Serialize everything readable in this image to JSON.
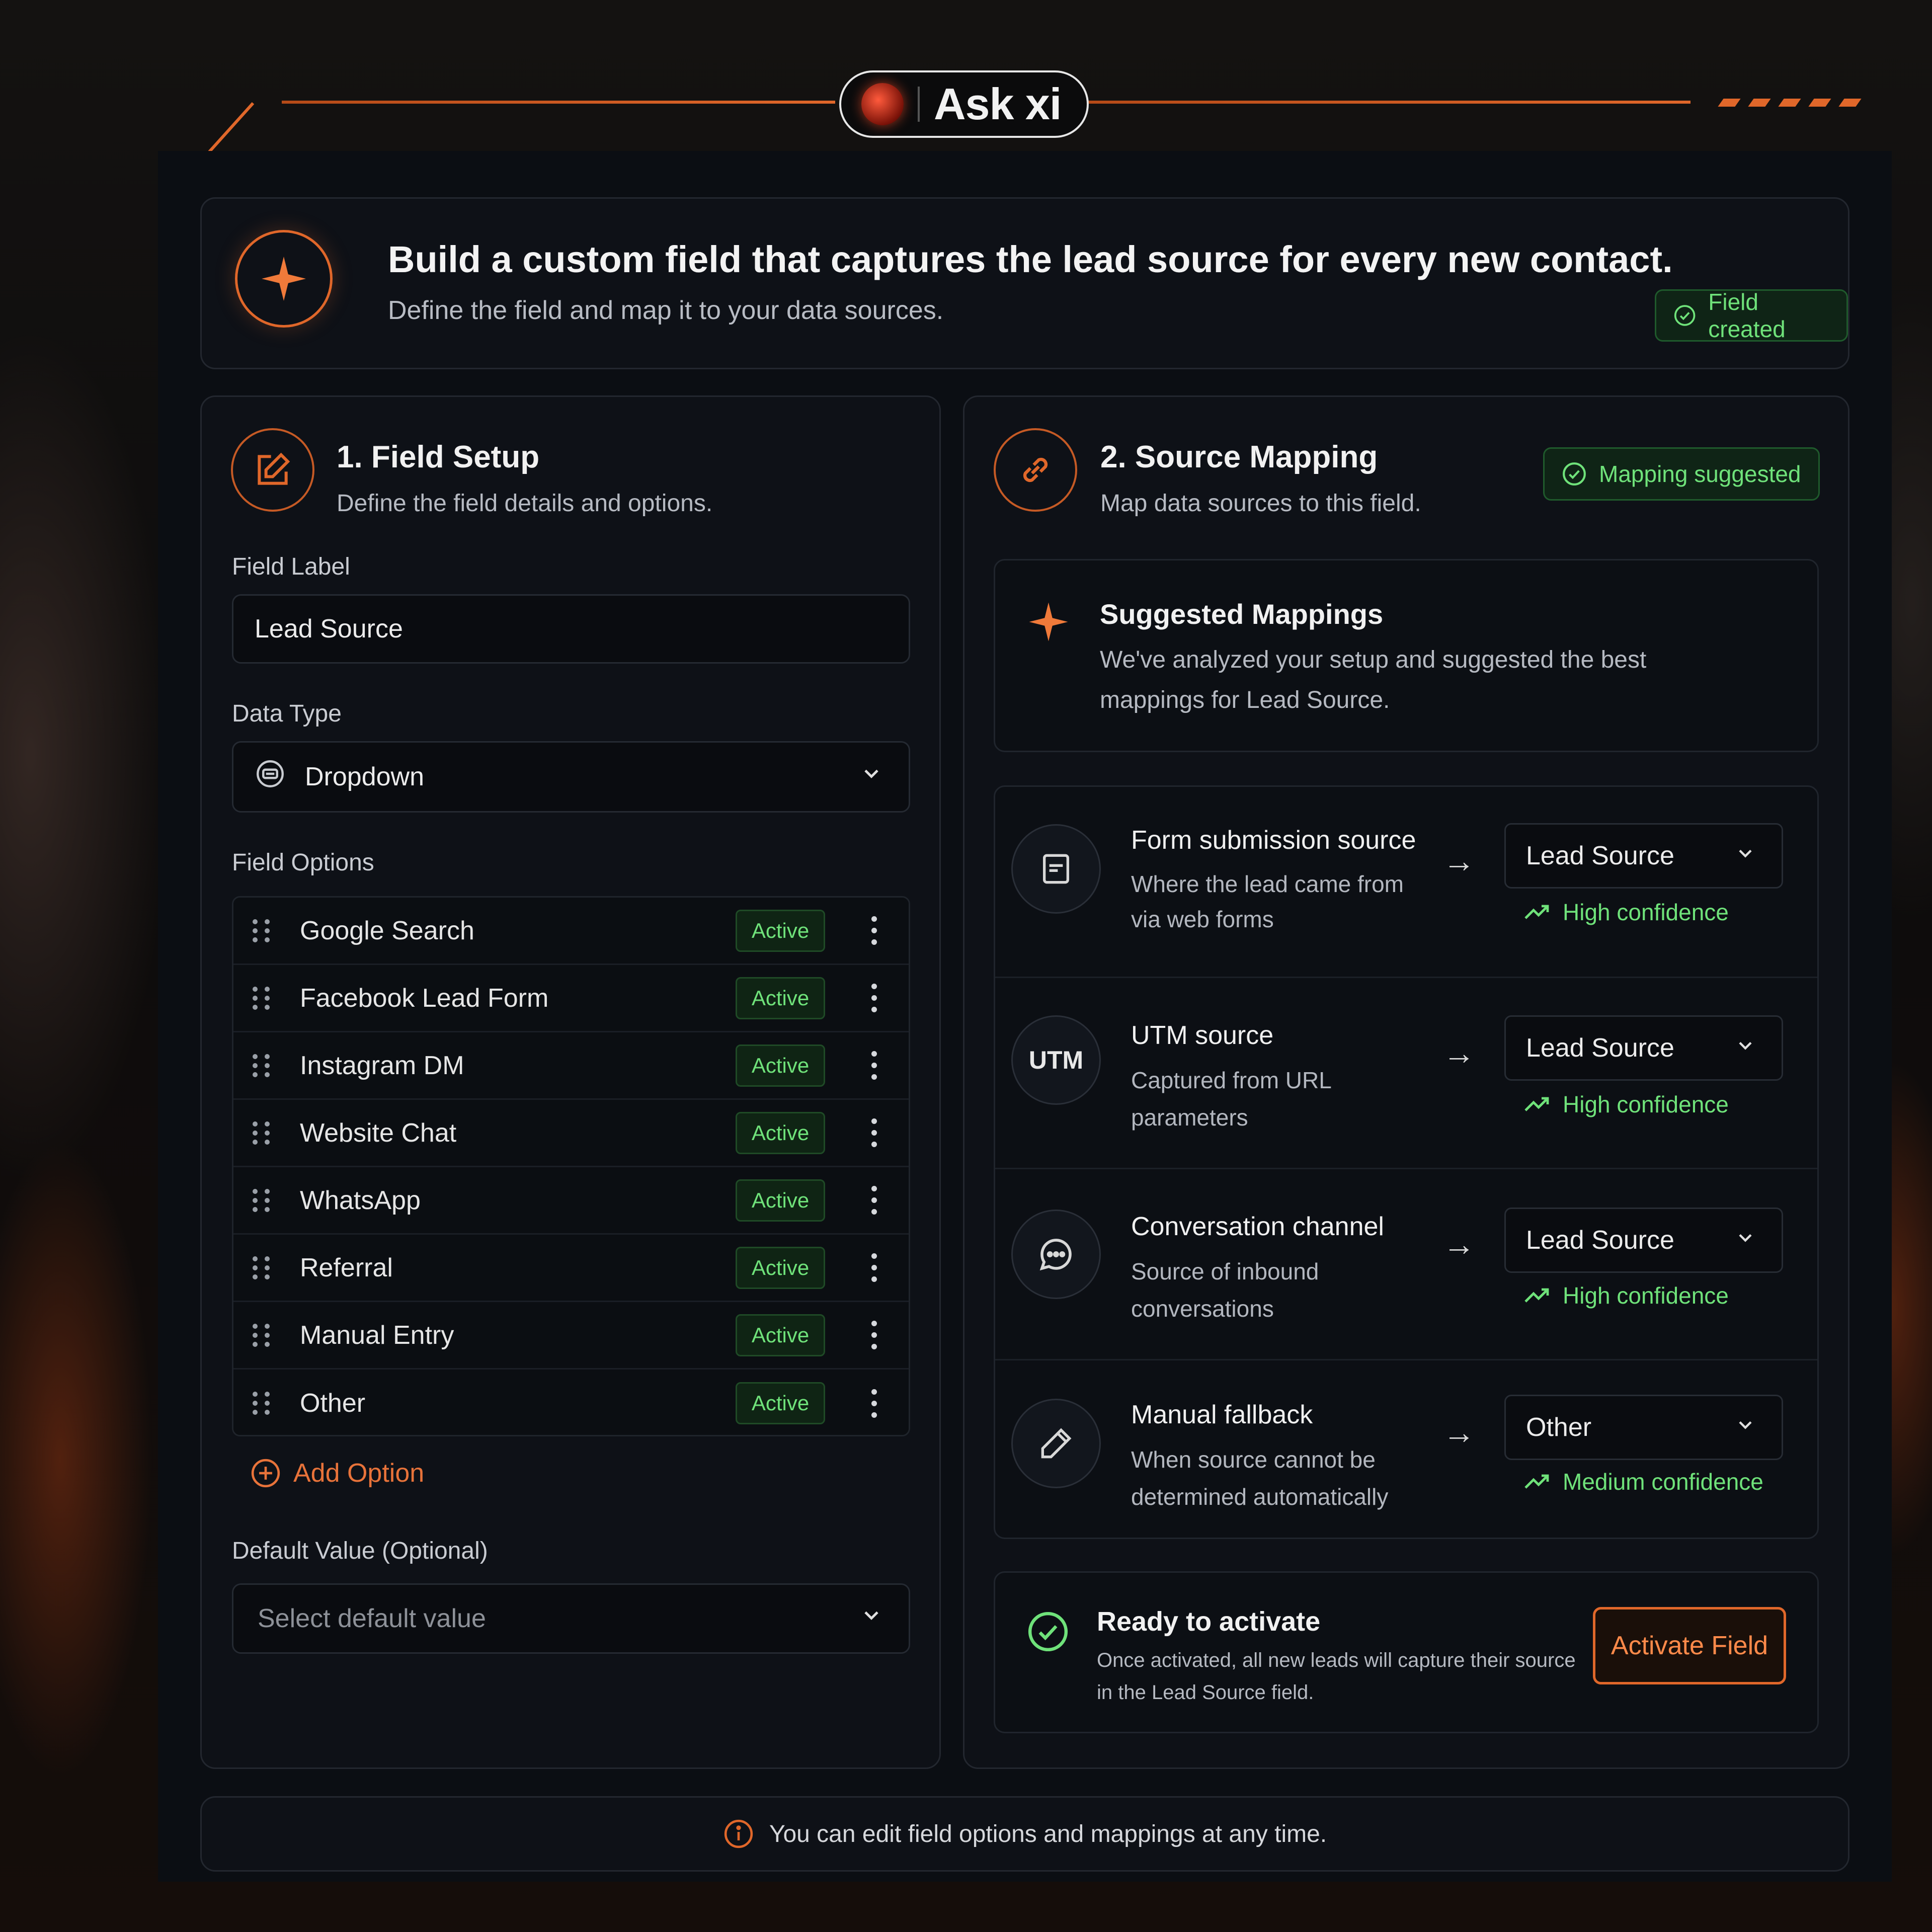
{
  "header": {
    "title": "Ask xi"
  },
  "hero": {
    "title": "Build a custom field that captures the lead source for every new contact.",
    "subtitle": "Define the field and map it to your data sources.",
    "status_badge": "Field created"
  },
  "field_setup": {
    "title": "1. Field Setup",
    "subtitle": "Define the field details and options.",
    "field_label_label": "Field Label",
    "field_label_value": "Lead Source",
    "data_type_label": "Data Type",
    "data_type_value": "Dropdown",
    "field_options_label": "Field Options",
    "options": [
      {
        "label": "Google Search",
        "status": "Active"
      },
      {
        "label": "Facebook Lead Form",
        "status": "Active"
      },
      {
        "label": "Instagram DM",
        "status": "Active"
      },
      {
        "label": "Website Chat",
        "status": "Active"
      },
      {
        "label": "WhatsApp",
        "status": "Active"
      },
      {
        "label": "Referral",
        "status": "Active"
      },
      {
        "label": "Manual Entry",
        "status": "Active"
      },
      {
        "label": "Other",
        "status": "Active"
      }
    ],
    "add_option_label": "Add Option",
    "default_value_label": "Default Value (Optional)",
    "default_value_placeholder": "Select default value"
  },
  "source_mapping": {
    "title": "2. Source Mapping",
    "subtitle": "Map data sources to this field.",
    "status_badge": "Mapping suggested",
    "suggested": {
      "title": "Suggested Mappings",
      "line1": "We've analyzed your setup and suggested the best",
      "line2": "mappings for Lead Source."
    },
    "mappings": [
      {
        "icon": "form-icon",
        "title": "Form submission source",
        "desc1": "Where the lead came from",
        "desc2": "via web forms",
        "target": "Lead Source",
        "confidence": "High confidence"
      },
      {
        "icon": "utm-icon",
        "icon_text": "UTM",
        "title": "UTM source",
        "desc1": "Captured from URL",
        "desc2": "parameters",
        "target": "Lead Source",
        "confidence": "High confidence"
      },
      {
        "icon": "chat-icon",
        "title": "Conversation channel",
        "desc1": "Source of inbound",
        "desc2": "conversations",
        "target": "Lead Source",
        "confidence": "High confidence"
      },
      {
        "icon": "pencil-icon",
        "title": "Manual fallback",
        "desc1": "When source cannot be",
        "desc2": "determined automatically",
        "target": "Other",
        "confidence": "Medium confidence"
      }
    ],
    "ready": {
      "title": "Ready to activate",
      "line1": "Once activated, all new leads will capture their source",
      "line2": "in the Lead Source field.",
      "button": "Activate Field"
    }
  },
  "footer": {
    "note": "You can edit field options and mappings at any time."
  },
  "colors": {
    "accent": "#e0672a",
    "success": "#6fe27a",
    "panel": "#0e1117"
  }
}
